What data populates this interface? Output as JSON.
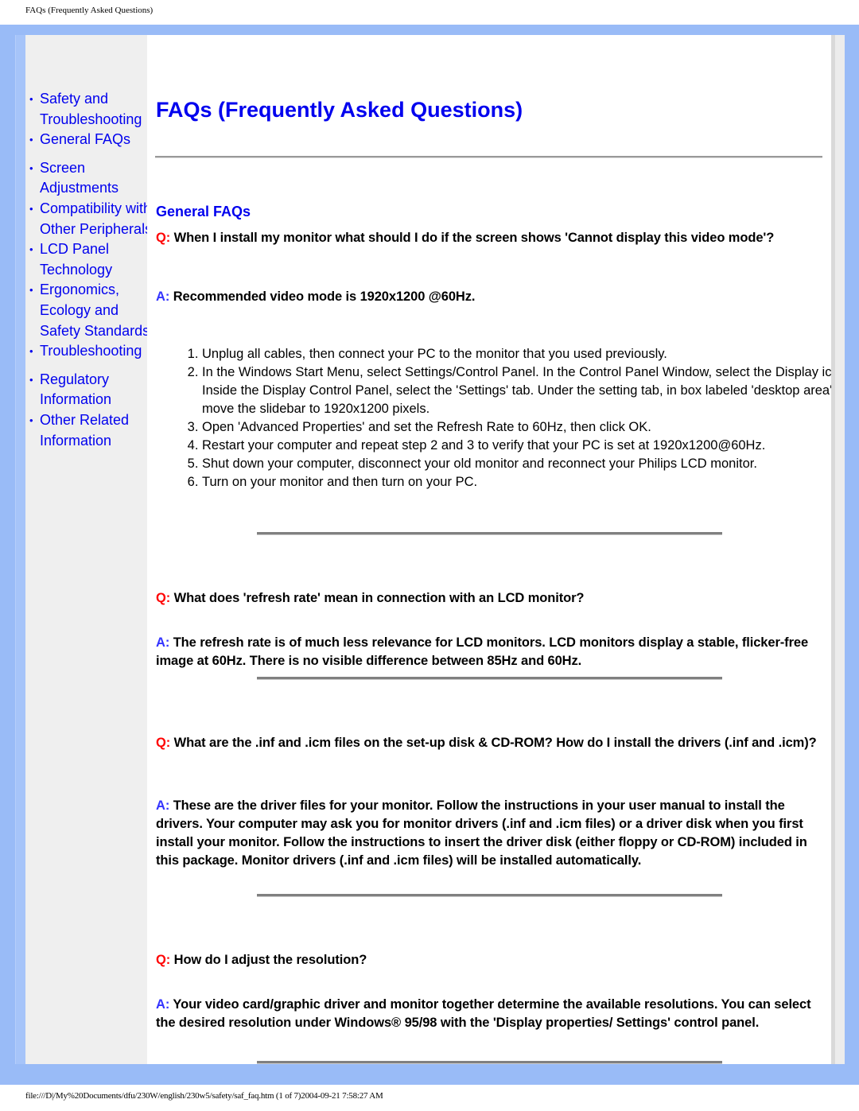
{
  "page_header": "FAQs (Frequently Asked Questions)",
  "footer": "file:///D|/My%20Documents/dfu/230W/english/230w5/safety/saf_faq.htm (1 of 7)2004-09-21 7:58:27 AM",
  "sidebar": {
    "items": [
      {
        "label": "Safety and Troubleshooting"
      },
      {
        "label": "General FAQs"
      },
      {
        "label": "Screen Adjustments"
      },
      {
        "label": "Compatibility with Other Peripherals"
      },
      {
        "label": "LCD Panel Technology"
      },
      {
        "label": "Ergonomics, Ecology and Safety Standards"
      },
      {
        "label": "Troubleshooting"
      },
      {
        "label": "Regulatory Information"
      },
      {
        "label": "Other Related Information"
      }
    ]
  },
  "main": {
    "title": "FAQs (Frequently Asked Questions)",
    "section_title": "General FAQs",
    "q_label": "Q:",
    "a_label": "A:",
    "faqs": [
      {
        "question": "When I install my monitor what should I do if the screen shows 'Cannot display this video mode'?",
        "answer": "Recommended video mode is 1920x1200 @60Hz.",
        "steps": [
          "Unplug all cables, then connect your PC to the monitor that you used previously.",
          "In the Windows Start Menu, select Settings/Control Panel. In the Control Panel Window, select the Display icon. Inside the Display Control Panel, select the 'Settings' tab. Under the setting tab, in box labeled 'desktop area', move the slidebar to 1920x1200 pixels.",
          "Open 'Advanced Properties' and set the Refresh Rate to 60Hz, then click OK.",
          "Restart your computer and repeat step 2 and 3 to verify that your PC is set at 1920x1200@60Hz.",
          "Shut down your computer, disconnect your old monitor and reconnect your Philips LCD monitor.",
          "Turn on your monitor and then turn on your PC."
        ]
      },
      {
        "question": "What does 'refresh rate' mean in connection with an LCD monitor?",
        "answer": "The refresh rate is of much less relevance for LCD monitors. LCD monitors display a stable, flicker-free image at 60Hz. There is no visible difference between 85Hz and 60Hz."
      },
      {
        "question": "What are the .inf and .icm files on the set-up disk & CD-ROM? How do I install the drivers (.inf and .icm)?",
        "answer": "These are the driver files for your monitor. Follow the instructions in your user manual to install the drivers. Your computer may ask you for monitor drivers (.inf and .icm files) or a driver disk when you first install your monitor. Follow the instructions to insert the driver disk (either floppy or CD-ROM) included in this package. Monitor drivers (.inf and .icm files) will be installed automatically."
      },
      {
        "question": "How do I adjust the resolution?",
        "answer": "Your video card/graphic driver and monitor together determine the available resolutions. You can select the desired resolution under Windows® 95/98 with the 'Display properties/ Settings' control panel."
      }
    ]
  }
}
